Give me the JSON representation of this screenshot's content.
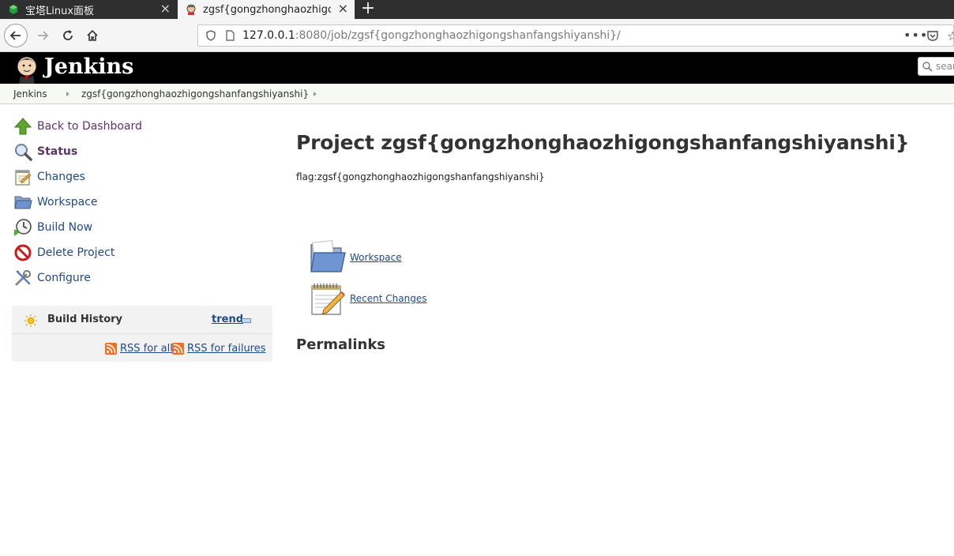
{
  "browser": {
    "tabs": [
      {
        "title": "宝塔Linux面板",
        "active": false
      },
      {
        "title": "zgsf{gongzhonghaozhigongshanfangshiyanshi}",
        "active": true
      }
    ],
    "url": {
      "host": "127.0.0.1",
      "rest": ":8080/job/zgsf{gongzhonghaozhigongshanfangshiyanshi}/"
    },
    "icons": [
      "back-icon",
      "forward-icon",
      "reload-icon",
      "home-icon",
      "shield-icon",
      "page-icon",
      "more-icon",
      "pocket-icon",
      "star-icon"
    ]
  },
  "jenkins": {
    "title": "Jenkins",
    "search_placeholder": "sear"
  },
  "breadcrumb": [
    "Jenkins",
    "zgsf{gongzhonghaozhigongshanfangshiyanshi}"
  ],
  "sidebar": {
    "tasks": [
      {
        "label": "Back to Dashboard",
        "icon": "up-arrow-icon"
      },
      {
        "label": "Status",
        "icon": "magnifier-icon"
      },
      {
        "label": "Changes",
        "icon": "notepad-icon"
      },
      {
        "label": "Workspace",
        "icon": "folder-icon"
      },
      {
        "label": "Build Now",
        "icon": "clock-icon"
      },
      {
        "label": "Delete Project",
        "icon": "no-entry-icon"
      },
      {
        "label": "Configure",
        "icon": "tools-icon"
      }
    ],
    "build_history": {
      "title": "Build History",
      "trend": "trend",
      "rss_all": "RSS for all",
      "rss_failures": "RSS for failures"
    }
  },
  "main": {
    "title": "Project zgsf{gongzhonghaozhigongshanfangshiyanshi}",
    "description": "flag:zgsf{gongzhonghaozhigongshanfangshiyanshi}",
    "links": [
      {
        "label": "Workspace",
        "icon": "folder-icon"
      },
      {
        "label": "Recent Changes",
        "icon": "notepad-icon"
      }
    ],
    "permalinks": "Permalinks"
  },
  "colors": {
    "header_bg": "#000000",
    "breadcrumb_bg": "#f6faf2",
    "link": "#204a87",
    "visited": "#5c3566"
  }
}
